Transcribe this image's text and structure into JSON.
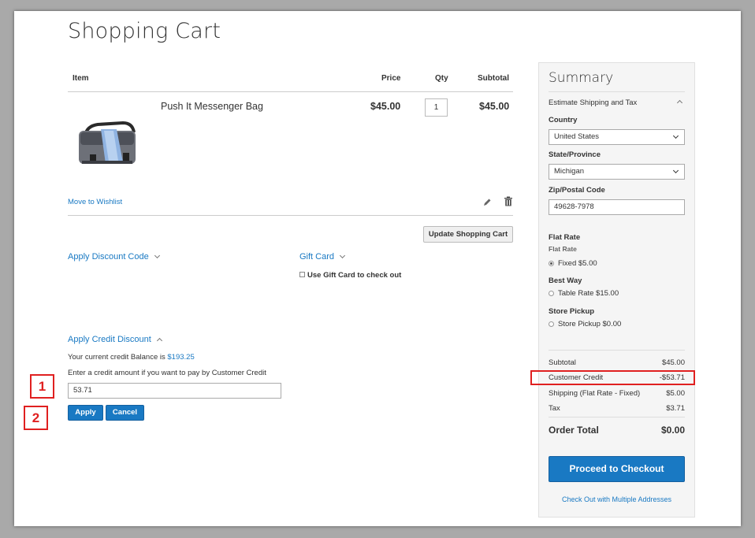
{
  "page": {
    "title": "Shopping Cart"
  },
  "cart": {
    "headers": {
      "item": "Item",
      "price": "Price",
      "qty": "Qty",
      "subtotal": "Subtotal"
    },
    "items": [
      {
        "name": "Push It Messenger Bag",
        "price": "$45.00",
        "qty": "1",
        "subtotal": "$45.00"
      }
    ],
    "move_to_wishlist": "Move to Wishlist",
    "update_button": "Update Shopping Cart"
  },
  "discount": {
    "label": "Apply Discount Code"
  },
  "gift_card": {
    "label": "Gift Card",
    "checkbox_label": "Use Gift Card to check out",
    "checked": false
  },
  "credit": {
    "label": "Apply Credit Discount",
    "balance_text": "Your current credit Balance is",
    "balance_value": "$193.25",
    "instruction": "Enter a credit amount if you want to pay by Customer Credit",
    "amount_value": "53.71",
    "apply_button": "Apply",
    "cancel_button": "Cancel"
  },
  "annotations": {
    "marker_1": "1",
    "marker_2": "2",
    "highlight_color": "#e02020"
  },
  "summary": {
    "title": "Summary",
    "estimate_label": "Estimate Shipping and Tax",
    "country_label": "Country",
    "country_value": "United States",
    "state_label": "State/Province",
    "state_value": "Michigan",
    "zip_label": "Zip/Postal Code",
    "zip_value": "49628-7978",
    "shipping_groups": [
      {
        "title": "Flat Rate",
        "subtitle": "Flat Rate",
        "option": "Fixed $5.00",
        "selected": true
      },
      {
        "title": "Best Way",
        "option": "Table Rate $15.00",
        "selected": false
      },
      {
        "title": "Store Pickup",
        "option": "Store Pickup $0.00",
        "selected": false
      }
    ],
    "totals": [
      {
        "label": "Subtotal",
        "value": "$45.00"
      },
      {
        "label": "Customer Credit",
        "value": "-$53.71"
      },
      {
        "label": "Shipping (Flat Rate - Fixed)",
        "value": "$5.00"
      },
      {
        "label": "Tax",
        "value": "$3.71"
      }
    ],
    "order_total_label": "Order Total",
    "order_total_value": "$0.00",
    "checkout_button": "Proceed to Checkout",
    "multi_address_link": "Check Out with Multiple Addresses"
  },
  "colors": {
    "accent": "#1979c3",
    "summary_bg": "#f5f5f5"
  }
}
